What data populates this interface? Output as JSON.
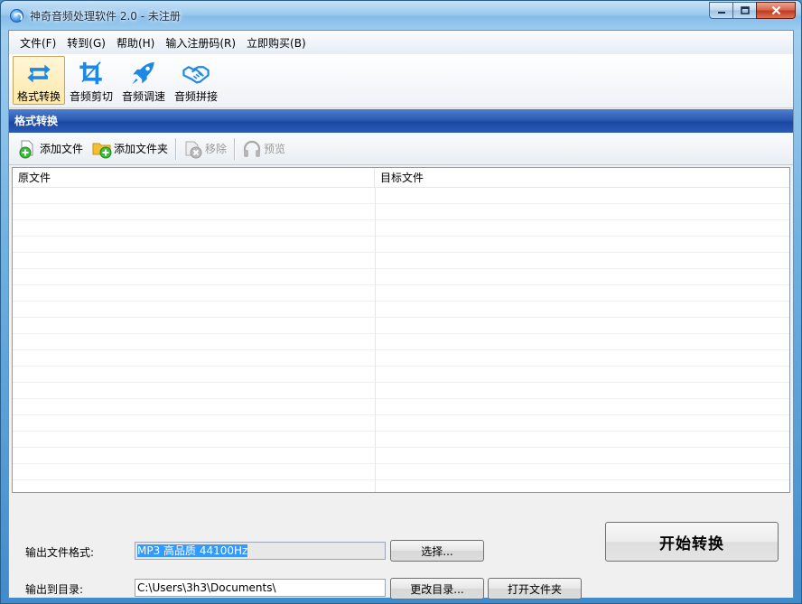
{
  "window": {
    "title": "神奇音频处理软件 2.0 - 未注册"
  },
  "menu": [
    "文件(F)",
    "转到(G)",
    "帮助(H)",
    "输入注册码(R)",
    "立即购买(B)"
  ],
  "tools": [
    {
      "label": "格式转换",
      "icon": "convert-icon",
      "active": true
    },
    {
      "label": "音频剪切",
      "icon": "crop-icon",
      "active": false
    },
    {
      "label": "音频调速",
      "icon": "rocket-icon",
      "active": false
    },
    {
      "label": "音频拼接",
      "icon": "handshake-icon",
      "active": false
    }
  ],
  "section": {
    "title": "格式转换"
  },
  "subtoolbar": {
    "add_file": "添加文件",
    "add_folder": "添加文件夹",
    "remove": "移除",
    "preview": "预览"
  },
  "filelist": {
    "col_source": "原文件",
    "col_target": "目标文件"
  },
  "bottom": {
    "format_label": "输出文件格式:",
    "format_value": "MP3 高品质 44100Hz",
    "choose_button": "选择...",
    "dir_label": "输出到目录:",
    "dir_value": "C:\\Users\\3h3\\Documents\\",
    "change_dir_button": "更改目录...",
    "open_folder_button": "打开文件夹",
    "start_button": "开始转换"
  },
  "colors": {
    "accent_blue": "#1e88e5",
    "header_blue": "#2a59b3"
  }
}
